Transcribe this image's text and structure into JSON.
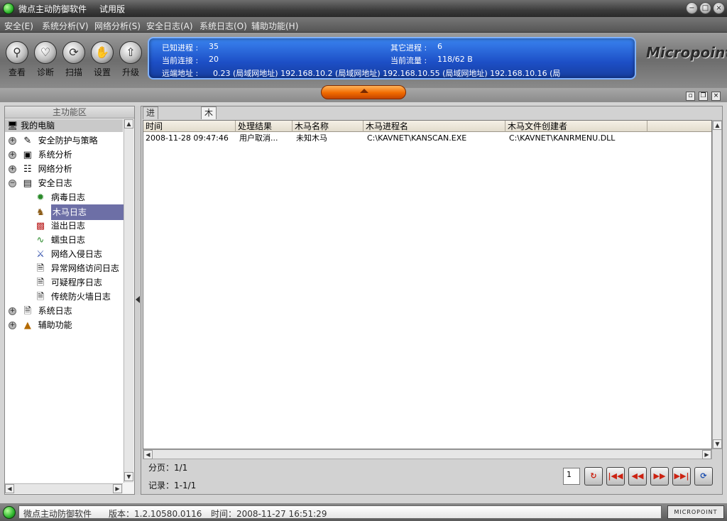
{
  "window": {
    "title": "微点主动防御软件",
    "edition": "试用版",
    "min_glyph": "−",
    "max_glyph": "□",
    "close_glyph": "×"
  },
  "menu": [
    "安全(E)",
    "系统分析(V)",
    "网络分析(S)",
    "安全日志(A)",
    "系统日志(O)",
    "辅助功能(H)"
  ],
  "toolbar": [
    {
      "label": "查看",
      "icon": "magnifier-icon"
    },
    {
      "label": "诊断",
      "icon": "heartbeat-icon"
    },
    {
      "label": "扫描",
      "icon": "scan-icon"
    },
    {
      "label": "设置",
      "icon": "settings-hand-icon"
    },
    {
      "label": "升级",
      "icon": "upgrade-icon"
    }
  ],
  "info": {
    "known_processes_label": "已知进程 :",
    "known_processes": "35",
    "other_processes_label": "其它进程 :",
    "other_processes": "6",
    "current_connections_label": "当前连接 :",
    "current_connections": "20",
    "current_traffic_label": "当前流量 :",
    "current_traffic": "118/62 B",
    "remote_address_label": "远端地址 :",
    "remote_addresses": "0.23 (局域网地址)    192.168.10.2 (局域网地址)    192.168.10.55 (局域网地址)    192.168.10.16 (局"
  },
  "logo": "Micropoint",
  "left_panel": {
    "header": "主功能区",
    "root": "我的电脑",
    "tree": [
      {
        "label": "安全防护与策略",
        "level": 0,
        "expander": "+"
      },
      {
        "label": "系统分析",
        "level": 0,
        "expander": "+"
      },
      {
        "label": "网络分析",
        "level": 0,
        "expander": "+"
      },
      {
        "label": "安全日志",
        "level": 0,
        "expander": "−"
      },
      {
        "label": "病毒日志",
        "level": 1
      },
      {
        "label": "木马日志",
        "level": 1,
        "selected": true
      },
      {
        "label": "溢出日志",
        "level": 1
      },
      {
        "label": "蠕虫日志",
        "level": 1
      },
      {
        "label": "网络入侵日志",
        "level": 1
      },
      {
        "label": "异常网络访问日志",
        "level": 1
      },
      {
        "label": "可疑程序日志",
        "level": 1
      },
      {
        "label": "传统防火墙日志",
        "level": 1
      },
      {
        "label": "系统日志",
        "level": 0,
        "expander": "+"
      },
      {
        "label": "辅助功能",
        "level": 0,
        "expander": "+"
      }
    ]
  },
  "tabs": [
    "进程综合信息",
    "木马日志"
  ],
  "table": {
    "columns": [
      "时间",
      "处理结果",
      "木马名称",
      "木马进程名",
      "木马文件创建者"
    ],
    "rows": [
      [
        "2008-11-28 09:47:46",
        "用户取消...",
        "未知木马",
        "C:\\KAVNET\\KANSCAN.EXE",
        "C:\\KAVNET\\KANRMENU.DLL"
      ]
    ]
  },
  "pager": {
    "page_text": "分页：1/1",
    "record_text": "记录：1-1/1",
    "page_input": "1"
  },
  "status": {
    "app": "微点主动防御软件",
    "version": "版本：1.2.10580.0116",
    "time": "时间：2008-11-27  16:51:29",
    "brand": "MICROPOINT"
  },
  "colors": {
    "info_panel": "#1d4fc6",
    "selected_item": "#6d6fa6",
    "orange_handle": "#f06a00"
  }
}
